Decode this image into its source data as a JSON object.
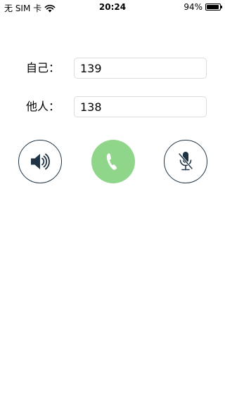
{
  "status_bar": {
    "carrier": "无 SIM 卡",
    "time": "20:24",
    "battery_percent": "94%",
    "battery_level": 0.94,
    "wifi_icon": "wifi-icon",
    "battery_icon": "battery-icon"
  },
  "form": {
    "self": {
      "label": "自己：",
      "value": "139"
    },
    "other": {
      "label": "他人：",
      "value": "138"
    }
  },
  "controls": {
    "speaker_icon": "speaker-icon",
    "call_icon": "phone-icon",
    "mute_icon": "mic-muted-icon",
    "outline_color": "#1f3345",
    "call_color": "#8fd68a"
  }
}
